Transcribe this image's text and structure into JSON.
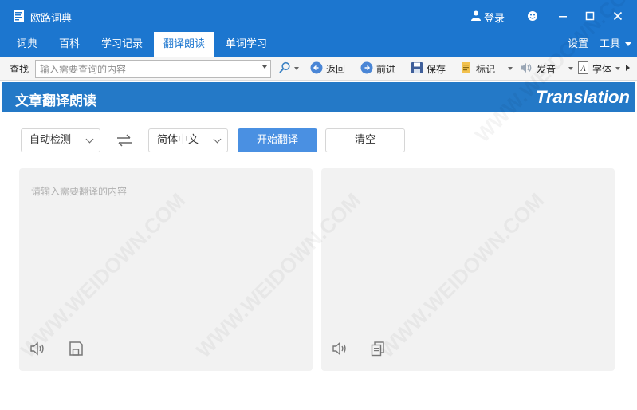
{
  "app": {
    "title": "欧路词典"
  },
  "titlebar": {
    "login_label": "登录"
  },
  "menu": {
    "tabs": [
      {
        "label": "词典"
      },
      {
        "label": "百科"
      },
      {
        "label": "学习记录"
      },
      {
        "label": "翻译朗读",
        "active": true
      },
      {
        "label": "单词学习"
      }
    ],
    "settings_label": "设置",
    "tools_label": "工具"
  },
  "toolbar": {
    "search_label": "查找",
    "search_placeholder": "输入需要查询的内容",
    "back_label": "返回",
    "forward_label": "前进",
    "save_label": "保存",
    "mark_label": "标记",
    "pronounce_label": "发音",
    "font_label": "字体"
  },
  "banner": {
    "title": "文章翻译朗读",
    "title_en": "Translation"
  },
  "translate": {
    "source_lang": "自动检测",
    "target_lang": "简体中文",
    "start_button": "开始翻译",
    "clear_button": "清空",
    "input_placeholder": "请输入需要翻译的内容"
  },
  "watermark": "WWW.WEIDOWN.COM",
  "colors": {
    "accent": "#1c76cf",
    "banner": "#2479c7",
    "primary_button": "#4a90e2",
    "panel_bg": "#f2f2f2"
  }
}
